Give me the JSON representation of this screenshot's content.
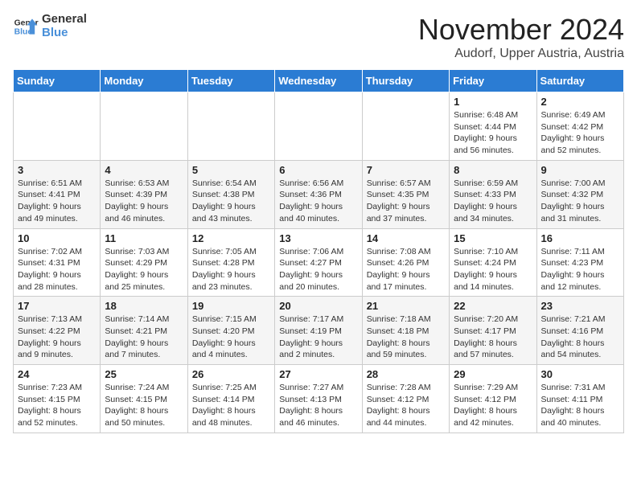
{
  "logo": {
    "line1": "General",
    "line2": "Blue"
  },
  "title": "November 2024",
  "location": "Audorf, Upper Austria, Austria",
  "days_of_week": [
    "Sunday",
    "Monday",
    "Tuesday",
    "Wednesday",
    "Thursday",
    "Friday",
    "Saturday"
  ],
  "weeks": [
    [
      {
        "day": "",
        "info": ""
      },
      {
        "day": "",
        "info": ""
      },
      {
        "day": "",
        "info": ""
      },
      {
        "day": "",
        "info": ""
      },
      {
        "day": "",
        "info": ""
      },
      {
        "day": "1",
        "info": "Sunrise: 6:48 AM\nSunset: 4:44 PM\nDaylight: 9 hours and 56 minutes."
      },
      {
        "day": "2",
        "info": "Sunrise: 6:49 AM\nSunset: 4:42 PM\nDaylight: 9 hours and 52 minutes."
      }
    ],
    [
      {
        "day": "3",
        "info": "Sunrise: 6:51 AM\nSunset: 4:41 PM\nDaylight: 9 hours and 49 minutes."
      },
      {
        "day": "4",
        "info": "Sunrise: 6:53 AM\nSunset: 4:39 PM\nDaylight: 9 hours and 46 minutes."
      },
      {
        "day": "5",
        "info": "Sunrise: 6:54 AM\nSunset: 4:38 PM\nDaylight: 9 hours and 43 minutes."
      },
      {
        "day": "6",
        "info": "Sunrise: 6:56 AM\nSunset: 4:36 PM\nDaylight: 9 hours and 40 minutes."
      },
      {
        "day": "7",
        "info": "Sunrise: 6:57 AM\nSunset: 4:35 PM\nDaylight: 9 hours and 37 minutes."
      },
      {
        "day": "8",
        "info": "Sunrise: 6:59 AM\nSunset: 4:33 PM\nDaylight: 9 hours and 34 minutes."
      },
      {
        "day": "9",
        "info": "Sunrise: 7:00 AM\nSunset: 4:32 PM\nDaylight: 9 hours and 31 minutes."
      }
    ],
    [
      {
        "day": "10",
        "info": "Sunrise: 7:02 AM\nSunset: 4:31 PM\nDaylight: 9 hours and 28 minutes."
      },
      {
        "day": "11",
        "info": "Sunrise: 7:03 AM\nSunset: 4:29 PM\nDaylight: 9 hours and 25 minutes."
      },
      {
        "day": "12",
        "info": "Sunrise: 7:05 AM\nSunset: 4:28 PM\nDaylight: 9 hours and 23 minutes."
      },
      {
        "day": "13",
        "info": "Sunrise: 7:06 AM\nSunset: 4:27 PM\nDaylight: 9 hours and 20 minutes."
      },
      {
        "day": "14",
        "info": "Sunrise: 7:08 AM\nSunset: 4:26 PM\nDaylight: 9 hours and 17 minutes."
      },
      {
        "day": "15",
        "info": "Sunrise: 7:10 AM\nSunset: 4:24 PM\nDaylight: 9 hours and 14 minutes."
      },
      {
        "day": "16",
        "info": "Sunrise: 7:11 AM\nSunset: 4:23 PM\nDaylight: 9 hours and 12 minutes."
      }
    ],
    [
      {
        "day": "17",
        "info": "Sunrise: 7:13 AM\nSunset: 4:22 PM\nDaylight: 9 hours and 9 minutes."
      },
      {
        "day": "18",
        "info": "Sunrise: 7:14 AM\nSunset: 4:21 PM\nDaylight: 9 hours and 7 minutes."
      },
      {
        "day": "19",
        "info": "Sunrise: 7:15 AM\nSunset: 4:20 PM\nDaylight: 9 hours and 4 minutes."
      },
      {
        "day": "20",
        "info": "Sunrise: 7:17 AM\nSunset: 4:19 PM\nDaylight: 9 hours and 2 minutes."
      },
      {
        "day": "21",
        "info": "Sunrise: 7:18 AM\nSunset: 4:18 PM\nDaylight: 8 hours and 59 minutes."
      },
      {
        "day": "22",
        "info": "Sunrise: 7:20 AM\nSunset: 4:17 PM\nDaylight: 8 hours and 57 minutes."
      },
      {
        "day": "23",
        "info": "Sunrise: 7:21 AM\nSunset: 4:16 PM\nDaylight: 8 hours and 54 minutes."
      }
    ],
    [
      {
        "day": "24",
        "info": "Sunrise: 7:23 AM\nSunset: 4:15 PM\nDaylight: 8 hours and 52 minutes."
      },
      {
        "day": "25",
        "info": "Sunrise: 7:24 AM\nSunset: 4:15 PM\nDaylight: 8 hours and 50 minutes."
      },
      {
        "day": "26",
        "info": "Sunrise: 7:25 AM\nSunset: 4:14 PM\nDaylight: 8 hours and 48 minutes."
      },
      {
        "day": "27",
        "info": "Sunrise: 7:27 AM\nSunset: 4:13 PM\nDaylight: 8 hours and 46 minutes."
      },
      {
        "day": "28",
        "info": "Sunrise: 7:28 AM\nSunset: 4:12 PM\nDaylight: 8 hours and 44 minutes."
      },
      {
        "day": "29",
        "info": "Sunrise: 7:29 AM\nSunset: 4:12 PM\nDaylight: 8 hours and 42 minutes."
      },
      {
        "day": "30",
        "info": "Sunrise: 7:31 AM\nSunset: 4:11 PM\nDaylight: 8 hours and 40 minutes."
      }
    ]
  ]
}
